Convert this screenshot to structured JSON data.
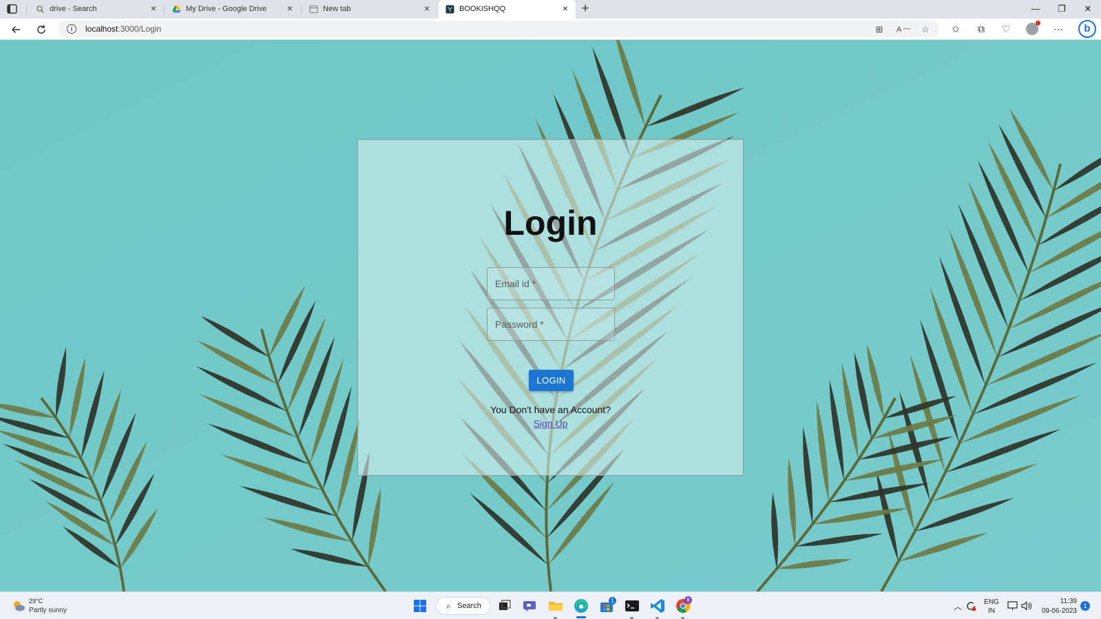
{
  "browser": {
    "tabs": [
      {
        "title": "drive - Search",
        "icon": "search-icon"
      },
      {
        "title": "My Drive - Google Drive",
        "icon": "google-drive-icon"
      },
      {
        "title": "New tab",
        "icon": "new-tab-page-icon"
      },
      {
        "title": "BOOKISHQQ",
        "icon": "site-favicon",
        "active": true
      }
    ],
    "address": {
      "host": "localhost",
      "path": ":3000/Login"
    }
  },
  "login": {
    "title": "Login",
    "email_placeholder": "Email id *",
    "password_placeholder": "Password *",
    "button_label": "LOGIN",
    "no_account_text": "You Don't have an Account?",
    "signup_link": "Sign Up"
  },
  "taskbar": {
    "weather": {
      "temp": "29°C",
      "desc": "Partly sunny"
    },
    "search_label": "Search",
    "apps": [
      {
        "name": "file-explorer"
      },
      {
        "name": "edge",
        "active": true
      },
      {
        "name": "microsoft-store",
        "badge": "1"
      },
      {
        "name": "terminal"
      },
      {
        "name": "vs-code"
      },
      {
        "name": "chrome",
        "badge": "8"
      }
    ],
    "tray": {
      "lang_top": "ENG",
      "lang_bottom": "IN",
      "time": "11:39",
      "date": "09-06-2023",
      "notifications": "1"
    }
  },
  "colors": {
    "background_sky": "#74c8c8",
    "login_button": "#1d76d2",
    "signup_link": "#5a3ea8",
    "leaf_dark": "#2e3328",
    "leaf_olive": "#6b7a45"
  }
}
